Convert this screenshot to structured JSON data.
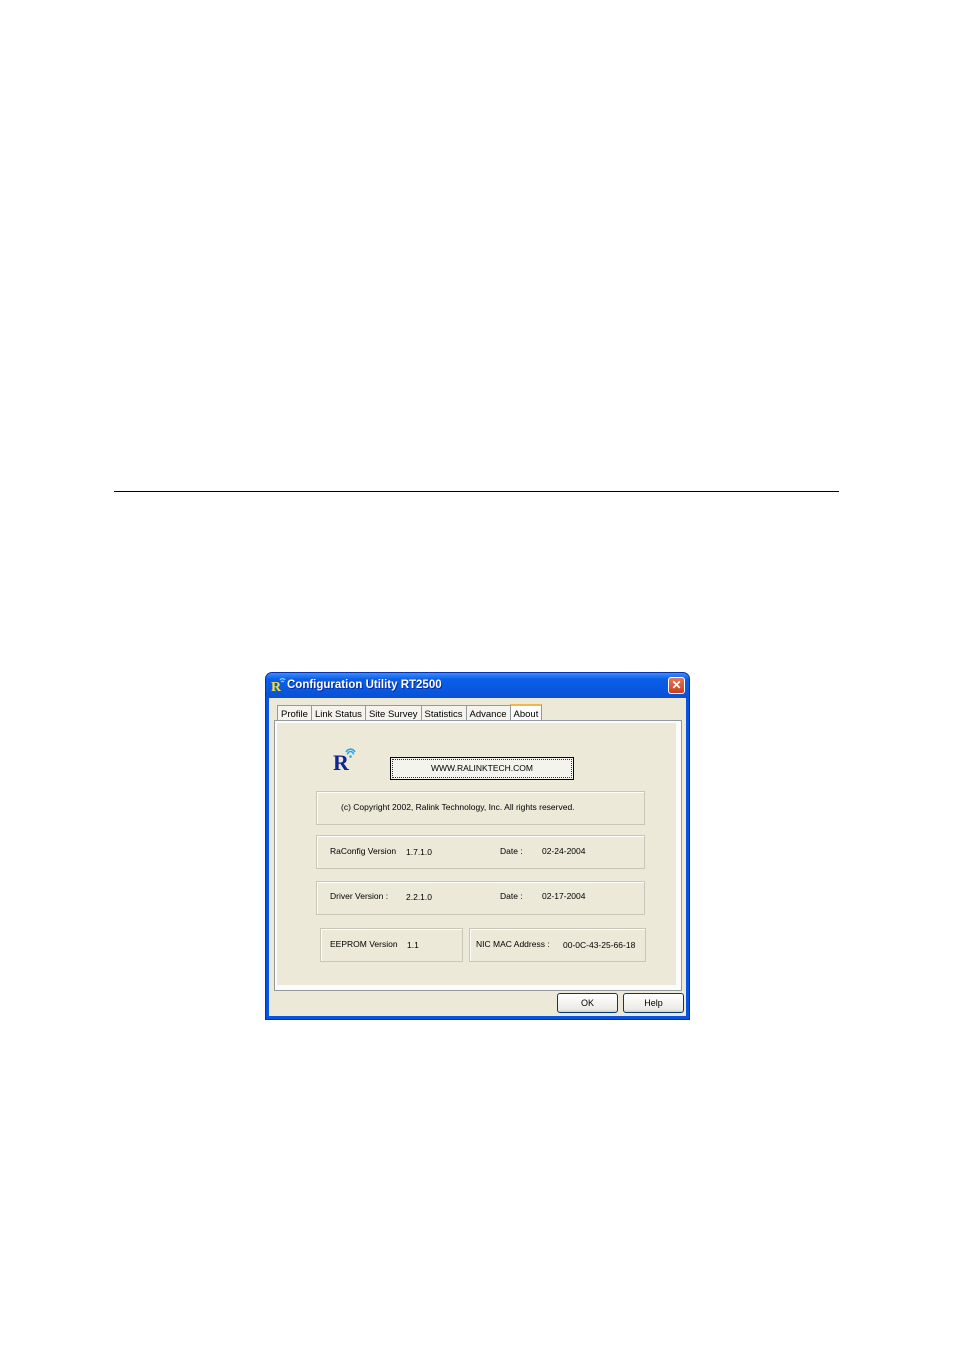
{
  "window": {
    "title": "Configuration Utility RT2500",
    "close_glyph": "✕"
  },
  "tabs": [
    "Profile",
    "Link Status",
    "Site Survey",
    "Statistics",
    "Advance",
    "About"
  ],
  "active_tab": "About",
  "about": {
    "logo_letter": "R",
    "website_button": "WWW.RALINKTECH.COM",
    "copyright": "(c) Copyright 2002, Ralink Technology, Inc.  All rights reserved.",
    "raconfig": {
      "label": "RaConfig Version",
      "version": "1.7.1.0",
      "date_label": "Date :",
      "date": "02-24-2004"
    },
    "driver": {
      "label": "Driver Version :",
      "version": "2.2.1.0",
      "date_label": "Date :",
      "date": "02-17-2004"
    },
    "eeprom": {
      "label": "EEPROM Version",
      "version": "1.1"
    },
    "mac": {
      "label": "NIC MAC Address :",
      "value": "00-0C-43-25-66-18"
    }
  },
  "buttons": {
    "ok": "OK",
    "help": "Help"
  },
  "colors": {
    "titlebar": "#0857e0",
    "face": "#ece9d8",
    "close": "#c4401d",
    "tab_highlight": "#f0b84a"
  },
  "icons": {
    "app": "ralink-logo-icon",
    "close": "close-icon"
  }
}
